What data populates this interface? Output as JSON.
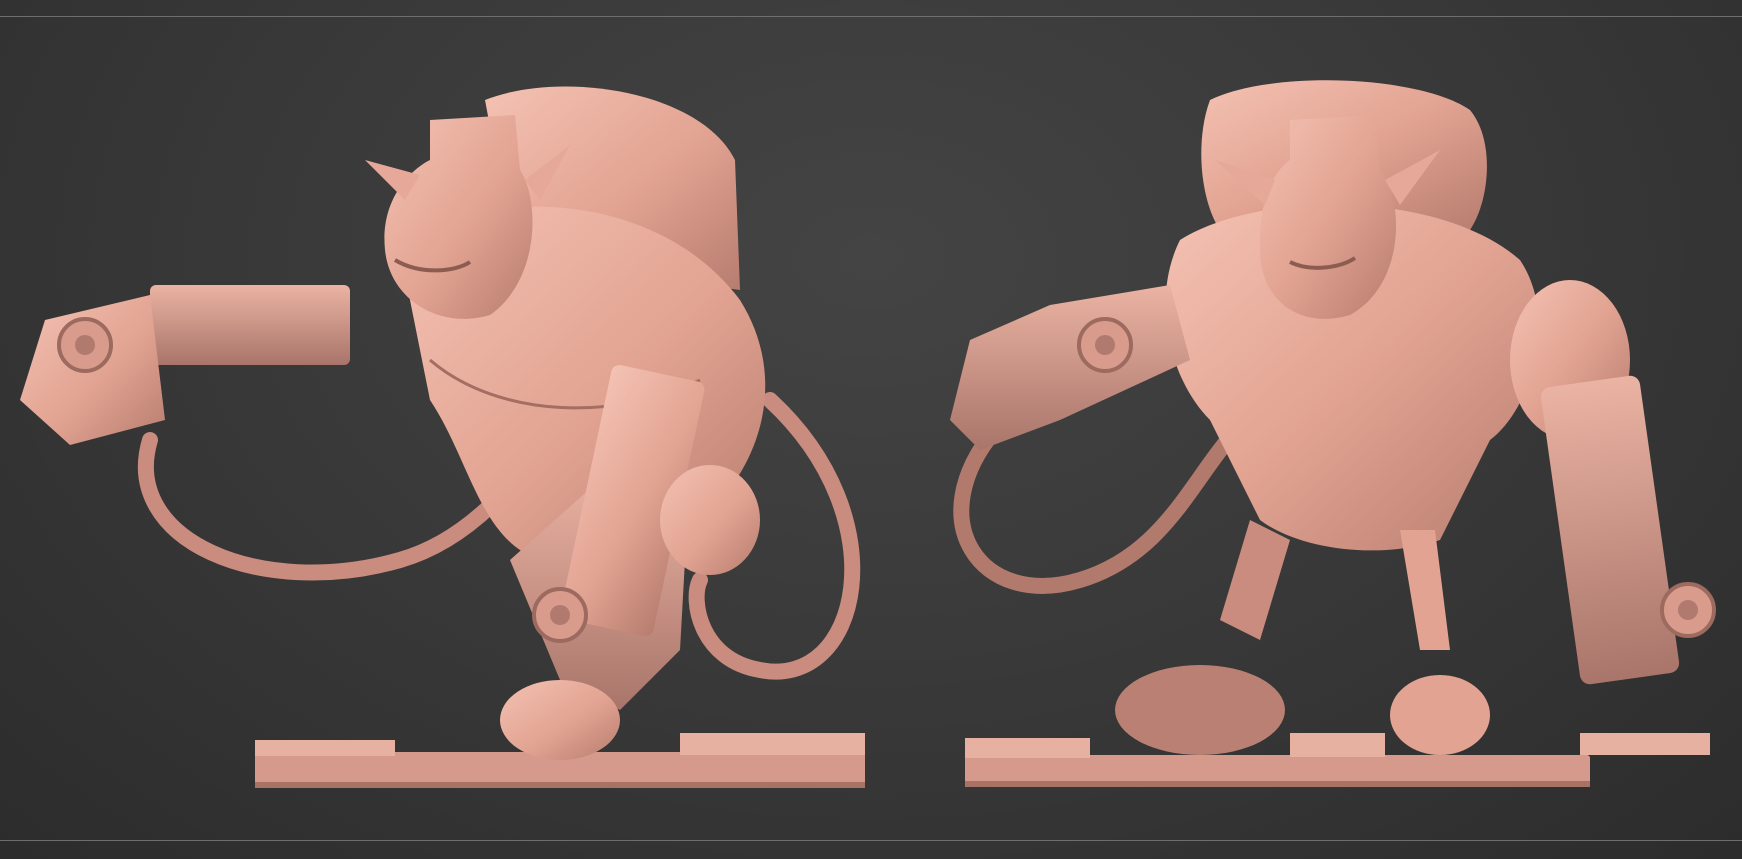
{
  "scene": {
    "background_color": "#3a3a3a",
    "clay_color": "#e6a898",
    "clay_shadow_color": "#9c6a5e",
    "views": [
      {
        "id": "front-three-quarter",
        "subject": "goblin-gunner-sculpt"
      },
      {
        "id": "front",
        "subject": "goblin-gunner-sculpt"
      }
    ]
  }
}
